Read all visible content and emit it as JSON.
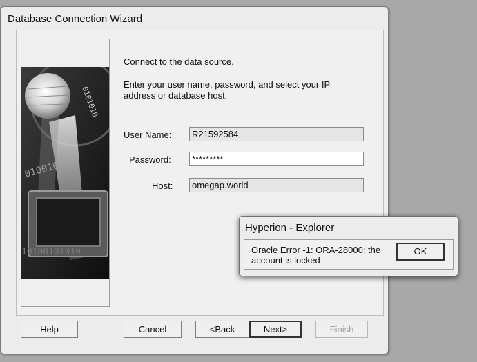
{
  "window": {
    "title": "Database Connection Wizard"
  },
  "intro": {
    "line1": "Connect to the data source.",
    "line2a": "Enter your user name, password, and select your IP",
    "line2b": "address or database host."
  },
  "form": {
    "user_name_label": "User Name:",
    "user_name_value": "R21592584",
    "password_label": "Password:",
    "password_value": "*********",
    "host_label": "Host:",
    "host_value": "omegap.world"
  },
  "buttons": {
    "help": "Help",
    "cancel": "Cancel",
    "back": "<Back",
    "next": "Next>",
    "finish": "Finish"
  },
  "dialog": {
    "title": "Hyperion - Explorer",
    "message_line1": "Oracle Error -1: ORA-28000: the",
    "message_line2": "account is locked",
    "ok": "OK"
  },
  "art": {
    "binary_text_1": "0101010",
    "binary_text_2": "010010",
    "binary_text_3": "10100101010"
  }
}
